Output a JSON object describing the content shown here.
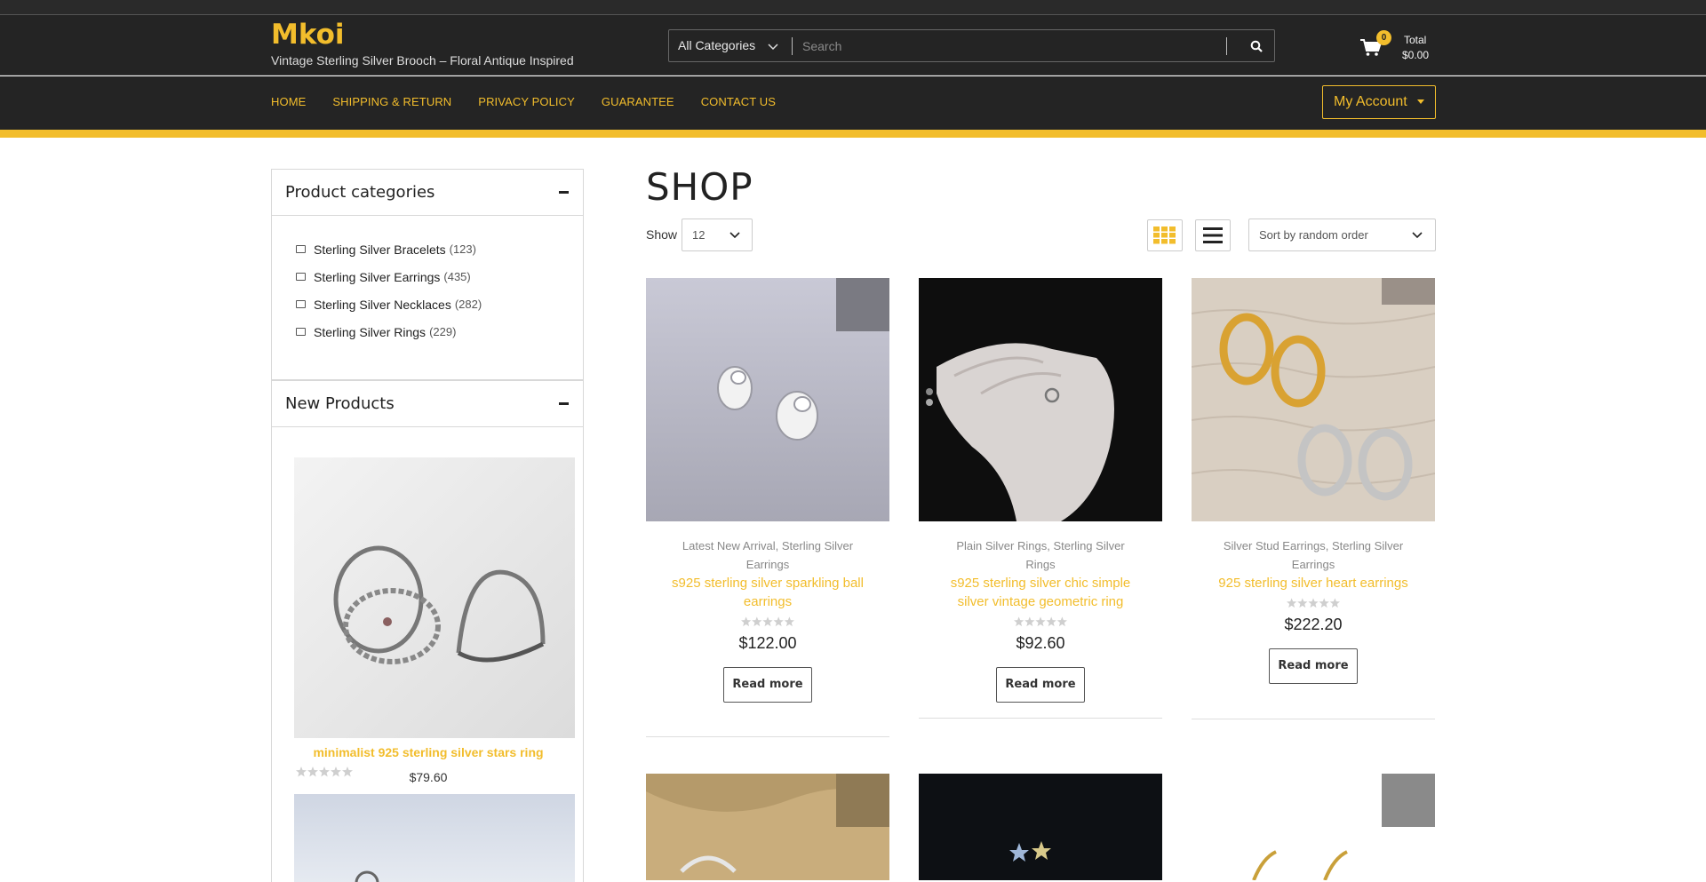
{
  "site": {
    "logo": "Mkoi",
    "tagline": "Vintage Sterling Silver Brooch – Floral Antique Inspired"
  },
  "search": {
    "category": "All Categories",
    "placeholder": "Search"
  },
  "cart": {
    "count": "0",
    "total_label": "Total",
    "total_value": "$0.00"
  },
  "nav": {
    "items": [
      "HOME",
      "SHIPPING & RETURN",
      "PRIVACY POLICY",
      "GUARANTEE",
      "CONTACT US"
    ],
    "account": "My Account"
  },
  "sidebar": {
    "categories_title": "Product categories",
    "categories": [
      {
        "name": "Sterling Silver Bracelets",
        "count": "(123)"
      },
      {
        "name": "Sterling Silver Earrings",
        "count": "(435)"
      },
      {
        "name": "Sterling Silver Necklaces",
        "count": "(282)"
      },
      {
        "name": "Sterling Silver Rings",
        "count": "(229)"
      }
    ],
    "new_products_title": "New Products",
    "new_products": [
      {
        "name": "minimalist 925 sterling silver stars ring",
        "price": "$79.60",
        "rating": 0
      }
    ]
  },
  "shop": {
    "title": "SHOP",
    "show_label": "Show",
    "show_value": "12",
    "sort_value": "Sort by random order"
  },
  "products": [
    {
      "categories": [
        "Latest New Arrival",
        "Sterling Silver Earrings"
      ],
      "name": "s925 sterling silver sparkling ball earrings",
      "price": "$122.00",
      "rating": 0,
      "button": "Read more"
    },
    {
      "categories": [
        "Plain Silver Rings",
        "Sterling Silver Rings"
      ],
      "name": "s925 sterling silver chic simple silver vintage geometric ring",
      "price": "$92.60",
      "rating": 0,
      "button": "Read more"
    },
    {
      "categories": [
        "Silver Stud Earrings",
        "Sterling Silver Earrings"
      ],
      "name": "925 sterling silver heart earrings",
      "price": "$222.20",
      "rating": 0,
      "button": "Read more"
    }
  ],
  "colors": {
    "accent": "#f2bd2c",
    "header_bg": "#242424",
    "text": "#222222"
  }
}
